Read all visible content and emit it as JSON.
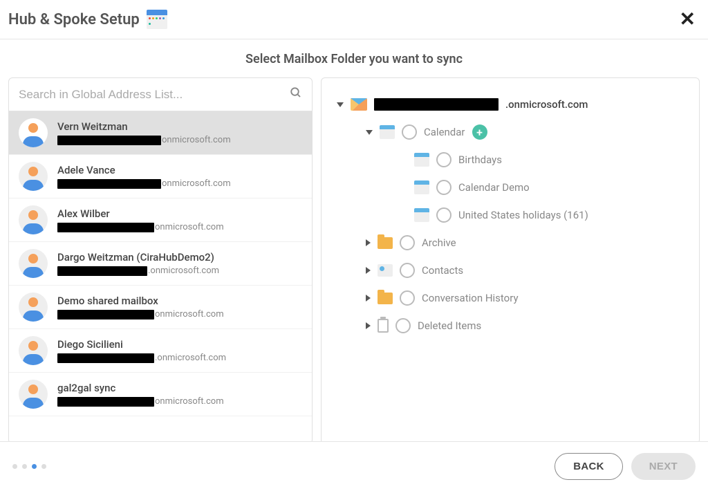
{
  "header": {
    "title": "Hub & Spoke Setup"
  },
  "subtitle": "Select Mailbox Folder you want to sync",
  "search": {
    "placeholder": "Search in Global Address List..."
  },
  "users": [
    {
      "name": "Vern Weitzman",
      "suffix": "onmicrosoft.com",
      "selected": true
    },
    {
      "name": "Adele Vance",
      "suffix": "onmicrosoft.com",
      "selected": false
    },
    {
      "name": "Alex Wilber",
      "suffix": "onmicrosoft.com",
      "selected": false
    },
    {
      "name": "Dargo Weitzman (CiraHubDemo2)",
      "suffix": ".onmicrosoft.com",
      "selected": false
    },
    {
      "name": "Demo shared mailbox",
      "suffix": "onmicrosoft.com",
      "selected": false
    },
    {
      "name": "Diego Sicilieni",
      "suffix": ".onmicrosoft.com",
      "selected": false
    },
    {
      "name": "gal2gal sync",
      "suffix": "onmicrosoft.com",
      "selected": false
    }
  ],
  "tree": {
    "root_suffix": ".onmicrosoft.com",
    "calendar": {
      "label": "Calendar",
      "children": [
        {
          "label": "Birthdays"
        },
        {
          "label": "Calendar Demo"
        },
        {
          "label": "United States holidays (161)"
        }
      ]
    },
    "folders": [
      {
        "label": "Archive",
        "icon": "folder"
      },
      {
        "label": "Contacts",
        "icon": "contacts"
      },
      {
        "label": "Conversation History",
        "icon": "folder"
      },
      {
        "label": "Deleted Items",
        "icon": "trash"
      }
    ]
  },
  "footer": {
    "back": "BACK",
    "next": "NEXT",
    "active_step": 2,
    "total_steps": 4
  }
}
